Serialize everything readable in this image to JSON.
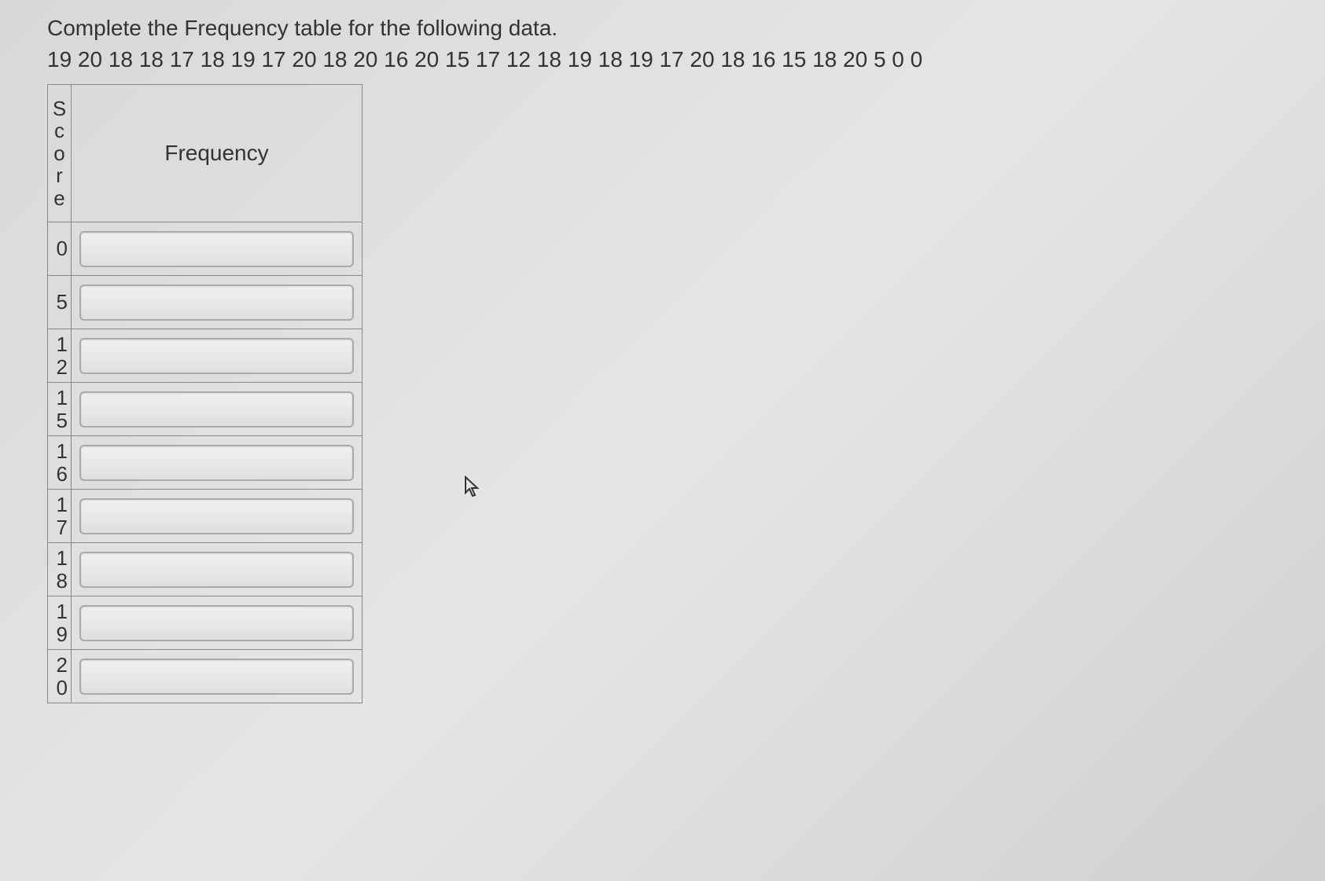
{
  "instruction": "Complete the Frequency table for the following data.",
  "data_line": "19 20 18 18 17 18 19 17 20 18 20 16 20 15 17 12 18 19 18 19 17 20 18 16 15 18 20 5 0 0",
  "headers": {
    "score": "Score",
    "frequency": "Frequency"
  },
  "rows": [
    {
      "score": "0",
      "frequency": ""
    },
    {
      "score": "5",
      "frequency": ""
    },
    {
      "score": "12",
      "frequency": ""
    },
    {
      "score": "15",
      "frequency": ""
    },
    {
      "score": "16",
      "frequency": ""
    },
    {
      "score": "17",
      "frequency": ""
    },
    {
      "score": "18",
      "frequency": ""
    },
    {
      "score": "19",
      "frequency": ""
    },
    {
      "score": "20",
      "frequency": ""
    }
  ]
}
